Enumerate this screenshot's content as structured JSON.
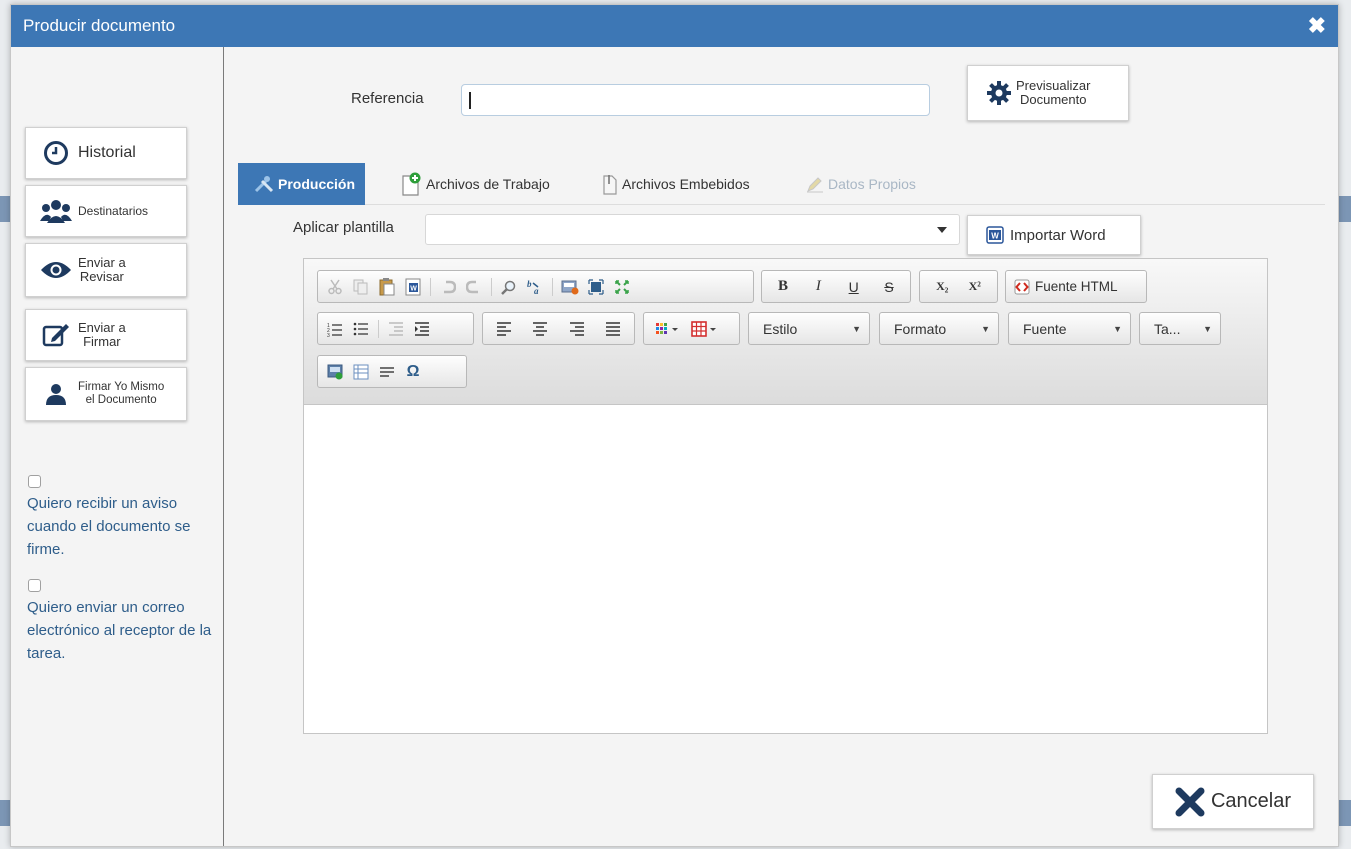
{
  "modal": {
    "title": "Producir documento",
    "close_glyph": "✖"
  },
  "sidebar": {
    "historial_label": "Historial",
    "destinatarios_label": "Destinatarios",
    "revisar_label_1": "Enviar a",
    "revisar_label_2": "Revisar",
    "firmar_label_1": "Enviar a",
    "firmar_label_2": "Firmar",
    "firmar_yo_label_1": "Firmar Yo Mismo",
    "firmar_yo_label_2": "el Documento",
    "notify_sign_label": "Quiero recibir un aviso cuando el documento se firme.",
    "notify_email_label": "Quiero enviar un correo electrónico al receptor de la tarea."
  },
  "main": {
    "referencia_label": "Referencia",
    "referencia_value": "",
    "preview_label_1": "Previsualizar",
    "preview_label_2": "Documento",
    "tabs": [
      {
        "label": "Producción",
        "state": "active",
        "icon": "tools-icon"
      },
      {
        "label": "Archivos de Trabajo",
        "state": "normal",
        "icon": "file-add-icon"
      },
      {
        "label": "Archivos Embebidos",
        "state": "normal",
        "icon": "paperclip-icon"
      },
      {
        "label": "Datos Propios",
        "state": "disabled",
        "icon": "pencil-icon"
      }
    ],
    "plantilla_label": "Aplicar plantilla",
    "plantilla_value": "",
    "import_word_label": "Importar Word"
  },
  "toolbar": {
    "bold": "B",
    "italic": "I",
    "underline": "U",
    "strike": "S",
    "subscript": "X₂",
    "superscript": "X²",
    "source_label": "Fuente HTML",
    "estilo_label": "Estilo",
    "formato_label": "Formato",
    "fuente_label": "Fuente",
    "tamano_label": "Ta...",
    "omega": "Ω"
  },
  "footer": {
    "cancel_label": "Cancelar"
  },
  "colors": {
    "header_blue": "#3d77b5",
    "text_blue": "#2e5d8a",
    "icon_navy": "#1e3a5f"
  }
}
